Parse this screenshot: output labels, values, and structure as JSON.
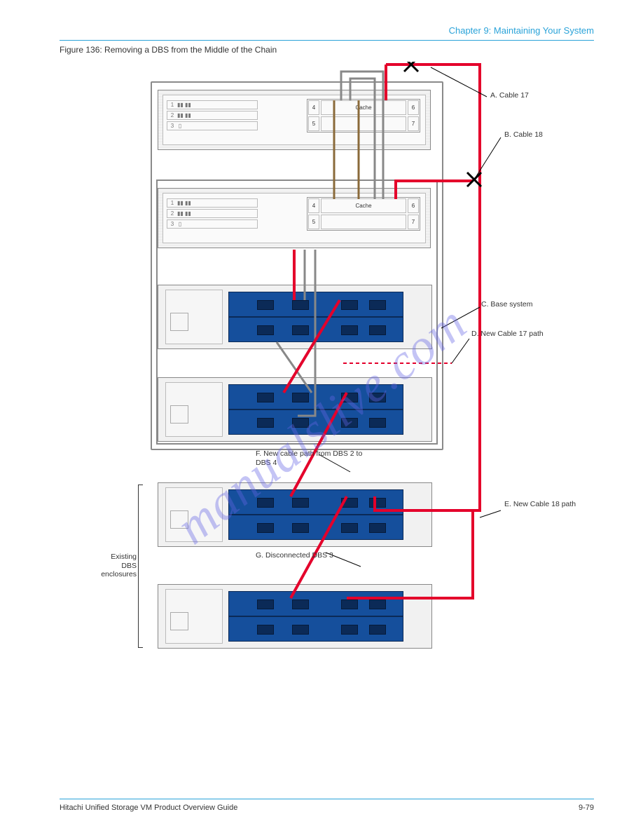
{
  "header": {
    "chapter": "Chapter 9: Maintaining Your System"
  },
  "figure": {
    "caption": "Figure 136: Removing a DBS from the Middle of the Chain"
  },
  "labels": {
    "a": "A. Cable 17",
    "b": "B. Cable 18",
    "c": "C. Base system",
    "d": "D. New Cable 17 path",
    "e": "E. New Cable 18 path",
    "f": "F. New cable path from DBS 2 to DBS 4",
    "g": "G. Disconnected DBS 3",
    "bracket": "Existing DBS enclosures"
  },
  "unit_text": {
    "cache": "Cache",
    "slot_numbers": [
      "1",
      "2",
      "3",
      "4",
      "5",
      "6",
      "7"
    ]
  },
  "watermark": "manualslive.com",
  "footer": {
    "doc": "Hitachi Unified Storage VM Product Overview Guide",
    "page": "9-79"
  }
}
